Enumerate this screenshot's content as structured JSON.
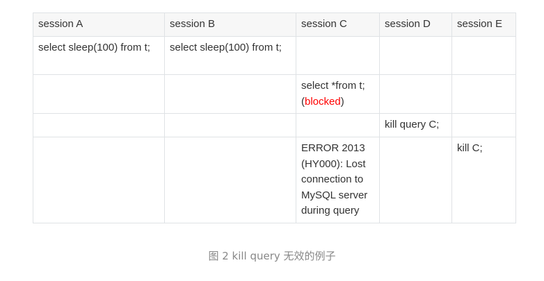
{
  "table": {
    "headers": [
      "session A",
      "session B",
      "session C",
      "session D",
      "session E"
    ],
    "rows": [
      {
        "a": "select sleep(100) from t;",
        "b": "select sleep(100) from t;",
        "c": "",
        "d": "",
        "e": ""
      },
      {
        "a": "",
        "b": "",
        "c_prefix": "select *from t; (",
        "c_highlight": "blocked",
        "c_suffix": ")",
        "d": "",
        "e": ""
      },
      {
        "a": "",
        "b": "",
        "c": "",
        "d": "kill query C;",
        "e": ""
      },
      {
        "a": "",
        "b": "",
        "c": "ERROR 2013 (HY000): Lost connection to MySQL server during query",
        "d": "",
        "e": "kill C;"
      }
    ]
  },
  "colors": {
    "highlight": "#ff0000",
    "border": "#dfe2e5",
    "header_bg": "#f7f7f7",
    "caption": "#888888"
  },
  "caption": "图 2 kill query 无效的例子"
}
